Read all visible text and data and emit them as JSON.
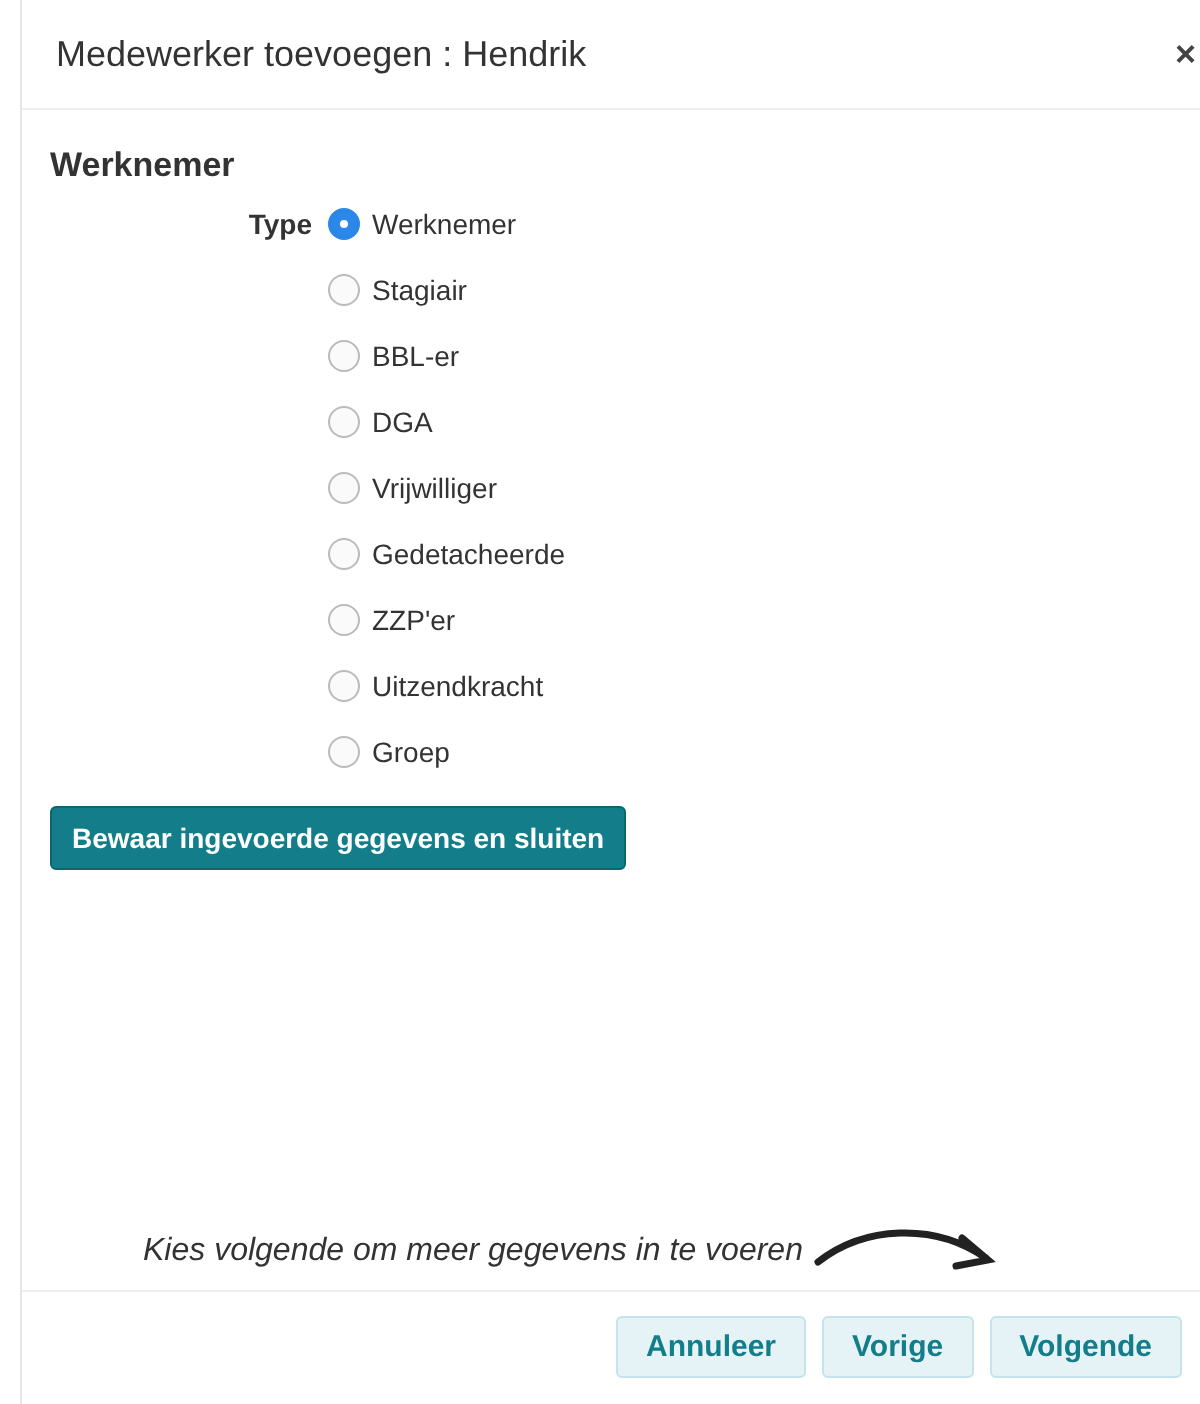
{
  "dialog": {
    "title": "Medewerker toevoegen : Hendrik",
    "close": "×"
  },
  "section": {
    "heading": "Werknemer",
    "field_label": "Type",
    "options": [
      {
        "label": "Werknemer",
        "selected": true
      },
      {
        "label": "Stagiair",
        "selected": false
      },
      {
        "label": "BBL-er",
        "selected": false
      },
      {
        "label": "DGA",
        "selected": false
      },
      {
        "label": "Vrijwilliger",
        "selected": false
      },
      {
        "label": "Gedetacheerde",
        "selected": false
      },
      {
        "label": "ZZP'er",
        "selected": false
      },
      {
        "label": "Uitzendkracht",
        "selected": false
      },
      {
        "label": "Groep",
        "selected": false
      }
    ],
    "save_button": "Bewaar ingevoerde gegevens en sluiten"
  },
  "hint": "Kies volgende om meer gegevens in te voeren",
  "footer_buttons": [
    "Annuleer",
    "Vorige",
    "Volgende"
  ]
}
